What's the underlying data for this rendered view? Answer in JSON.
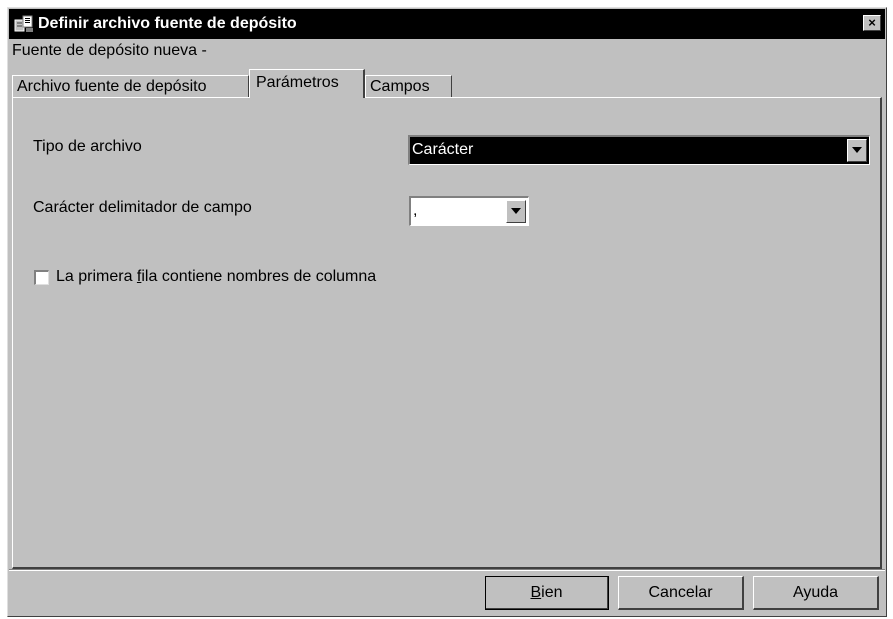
{
  "window": {
    "title": "Definir archivo fuente de depósito",
    "close_label": "×",
    "subtitle": "Fuente de depósito nueva -"
  },
  "tabs": [
    {
      "label": "Archivo fuente de depósito",
      "active": false
    },
    {
      "label": "Parámetros",
      "active": true
    },
    {
      "label": "Campos",
      "active": false
    }
  ],
  "fields": {
    "file_type_label": "Tipo de archivo",
    "file_type_value": "Carácter",
    "delimiter_label": "Carácter delimitador de campo",
    "delimiter_value": ",",
    "first_row_pre": "La primera ",
    "first_row_mnemonic": "f",
    "first_row_post": "ila contiene nombres de columna",
    "first_row_checked": false
  },
  "buttons": {
    "ok_mnemonic": "B",
    "ok_rest": "ien",
    "cancel": "Cancelar",
    "help": "Ayuda"
  },
  "colors": {
    "window_bg": "#c0c0c0",
    "titlebar_bg": "#000000",
    "selection_bg": "#000000"
  }
}
